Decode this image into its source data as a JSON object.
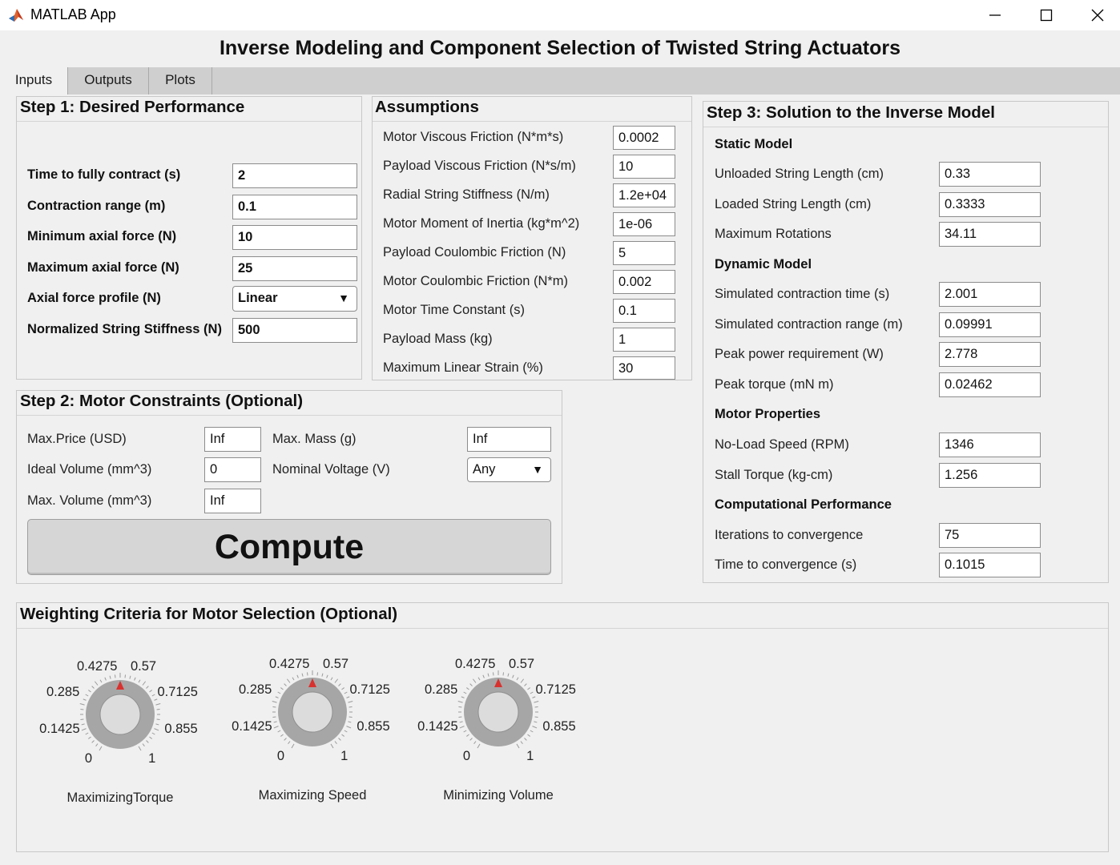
{
  "window": {
    "title": "MATLAB App",
    "icon": "matlab-icon"
  },
  "header": {
    "title": "Inverse Modeling and Component Selection of Twisted String Actuators"
  },
  "tabs": [
    {
      "label": "Inputs",
      "active": true
    },
    {
      "label": "Outputs",
      "active": false
    },
    {
      "label": "Plots",
      "active": false
    }
  ],
  "step1": {
    "title": "Step 1: Desired Performance",
    "fields": [
      {
        "label": "Time to fully contract (s)",
        "value": "2"
      },
      {
        "label": "Contraction range (m)",
        "value": "0.1"
      },
      {
        "label": "Minimum axial force (N)",
        "value": "10"
      },
      {
        "label": "Maximum axial force (N)",
        "value": "25"
      }
    ],
    "profile": {
      "label": "Axial force profile (N)",
      "value": "Linear"
    },
    "stiffness": {
      "label": "Normalized String Stiffness (N)",
      "value": "500"
    }
  },
  "assumptions": {
    "title": "Assumptions",
    "fields": [
      {
        "label": "Motor Viscous Friction (N*m*s)",
        "value": "0.0002"
      },
      {
        "label": "Payload Viscous Friction (N*s/m)",
        "value": "10"
      },
      {
        "label": "Radial String Stiffness (N/m)",
        "value": "1.2e+04"
      },
      {
        "label": "Motor Moment of Inertia (kg*m^2)",
        "value": "1e-06"
      },
      {
        "label": "Payload Coulombic Friction (N)",
        "value": "5"
      },
      {
        "label": "Motor Coulombic Friction (N*m)",
        "value": "0.002"
      },
      {
        "label": "Motor Time Constant (s)",
        "value": "0.1"
      },
      {
        "label": "Payload Mass (kg)",
        "value": "1"
      },
      {
        "label": "Maximum Linear Strain (%)",
        "value": "30"
      }
    ]
  },
  "step2": {
    "title": "Step 2: Motor Constraints (Optional)",
    "max_price": {
      "label": "Max.Price (USD)",
      "value": "Inf"
    },
    "ideal_volume": {
      "label": "Ideal Volume (mm^3)",
      "value": "0"
    },
    "max_volume": {
      "label": "Max. Volume (mm^3)",
      "value": "Inf"
    },
    "max_mass": {
      "label": "Max. Mass (g)",
      "value": "Inf"
    },
    "nominal_voltage": {
      "label": "Nominal Voltage (V)",
      "value": "Any"
    },
    "compute_label": "Compute"
  },
  "step3": {
    "title": "Step 3: Solution to the Inverse Model",
    "static_heading": "Static Model",
    "static": [
      {
        "label": "Unloaded String Length (cm)",
        "value": "0.33"
      },
      {
        "label": "Loaded String Length (cm)",
        "value": "0.3333"
      },
      {
        "label": "Maximum Rotations",
        "value": "34.11"
      }
    ],
    "dynamic_heading": "Dynamic Model",
    "dynamic": [
      {
        "label": "Simulated contraction time (s)",
        "value": "2.001"
      },
      {
        "label": "Simulated contraction range (m)",
        "value": "0.09991"
      },
      {
        "label": "Peak power requirement (W)",
        "value": "2.778"
      },
      {
        "label": "Peak torque (mN m)",
        "value": "0.02462"
      }
    ],
    "motor_heading": "Motor Properties",
    "motor": [
      {
        "label": "No-Load Speed (RPM)",
        "value": "1346"
      },
      {
        "label": "Stall Torque (kg-cm)",
        "value": "1.256"
      }
    ],
    "comp_heading": "Computational Performance",
    "comp": [
      {
        "label": "Iterations to convergence",
        "value": "75"
      },
      {
        "label": "Time to convergence (s)",
        "value": "0.1015"
      }
    ]
  },
  "weighting": {
    "title": "Weighting Criteria for Motor Selection (Optional)",
    "tick_labels": [
      "0",
      "0.1425",
      "0.285",
      "0.4275",
      "0.57",
      "0.7125",
      "0.855",
      "1"
    ],
    "knobs": [
      {
        "label": "MaximizingTorque",
        "value": 0.5
      },
      {
        "label": "Maximizing Speed",
        "value": 0.5
      },
      {
        "label": "Minimizing Volume",
        "value": 0.5
      }
    ]
  },
  "colors": {
    "accent": "#d9312e",
    "tab_bar": "#cfcfcf",
    "background": "#f0f0f0"
  }
}
